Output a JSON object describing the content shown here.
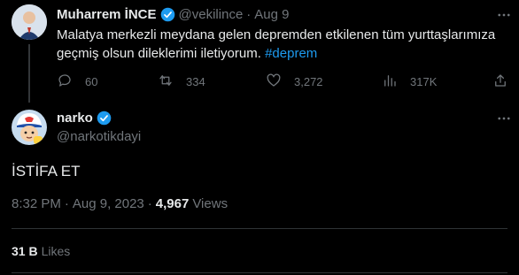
{
  "parent_tweet": {
    "author_name": "Muharrem İNCE",
    "handle": "@vekilince",
    "separator": "·",
    "date": "Aug 9",
    "text_line1": "Malatya merkezli meydana gelen depremden etkilenen tüm yurttaşlarımıza",
    "text_line2": "geçmiş olsun dileklerimi iletiyorum.",
    "hashtag": "#deprem",
    "replies": "60",
    "reposts": "334",
    "likes": "3,272",
    "views": "317K",
    "icons": [
      "reply-icon",
      "repost-icon",
      "like-icon",
      "views-icon",
      "share-icon"
    ]
  },
  "main_tweet": {
    "author_name": "narko",
    "handle": "@narkotikdayi",
    "text": "İSTİFA ET",
    "time": "8:32 PM",
    "separator": "·",
    "date": "Aug 9, 2023",
    "separator2": "·",
    "views_count": "4,967",
    "views_label": "Views",
    "likes_count": "31 B",
    "likes_label": "Likes"
  },
  "colors": {
    "background": "#000000",
    "text": "#e7e9ea",
    "muted": "#71767b",
    "accent": "#1d9bf0",
    "divider": "#2f3336"
  }
}
